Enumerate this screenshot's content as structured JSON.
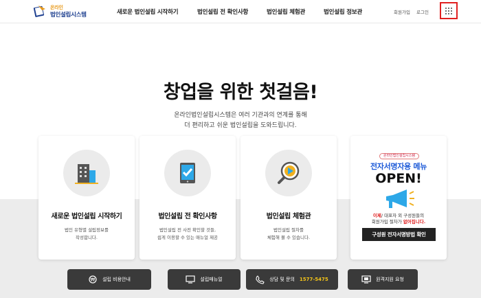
{
  "logo": {
    "top_text": "온라인",
    "main_text": "법인설립시스템"
  },
  "nav": [
    {
      "label": "새로운 법인설립 시작하기"
    },
    {
      "label": "법인설립 전 확인사항"
    },
    {
      "label": "법인설립 체험관"
    },
    {
      "label": "법인설립 정보관"
    }
  ],
  "util": {
    "signup": "회원가입",
    "login": "로그인"
  },
  "hero": {
    "title": "창업을 위한 첫걸음!",
    "sub_line1": "온라인법인설립시스템은 여러 기관과의 연계를 통해",
    "sub_line2": "더 편리하고 쉬운 법인설립을 도와드립니다."
  },
  "cards": [
    {
      "title": "새로운 법인설립 시작하기",
      "desc1": "법인 유형별 설립정보를",
      "desc2": "작성합니다.",
      "icon": "building-icon"
    },
    {
      "title": "법인설립 전 확인사항",
      "desc1": "법인설립 전 사전 확인할 것들,",
      "desc2": "쉽게 이용할 수 있는 매뉴얼 제공",
      "icon": "tablet-check-icon"
    },
    {
      "title": "법인설립 체험관",
      "desc1": "법인설립 절차를",
      "desc2": "체험해 볼 수 있습니다.",
      "icon": "magnifier-play-icon"
    }
  ],
  "promo": {
    "badge": "온라인법인설립시스템",
    "line1": "전자서명자용 메뉴",
    "line2": "OPEN!",
    "t1_red": "이제",
    "t1_rest": "/ 대표자 외 구성원들의",
    "t2_pre": "회원가입 절차가 ",
    "t2_red": "없어집니다.",
    "button": "구성원 전자서명방법 확인"
  },
  "bottom": [
    {
      "label": "설립 비용안내",
      "icon": "coin-icon"
    },
    {
      "label": "설립매뉴얼",
      "icon": "monitor-icon"
    },
    {
      "label": "상담 및 문의",
      "phone": "1577-5475",
      "icon": "phone-icon"
    },
    {
      "label": "원격지원 요청",
      "icon": "remote-monitor-icon"
    }
  ],
  "colors": {
    "brand_blue": "#1d3f8f",
    "accent_red": "#e02020",
    "promo_blue": "#1d5bd8",
    "phone_yellow": "#f5c518"
  }
}
